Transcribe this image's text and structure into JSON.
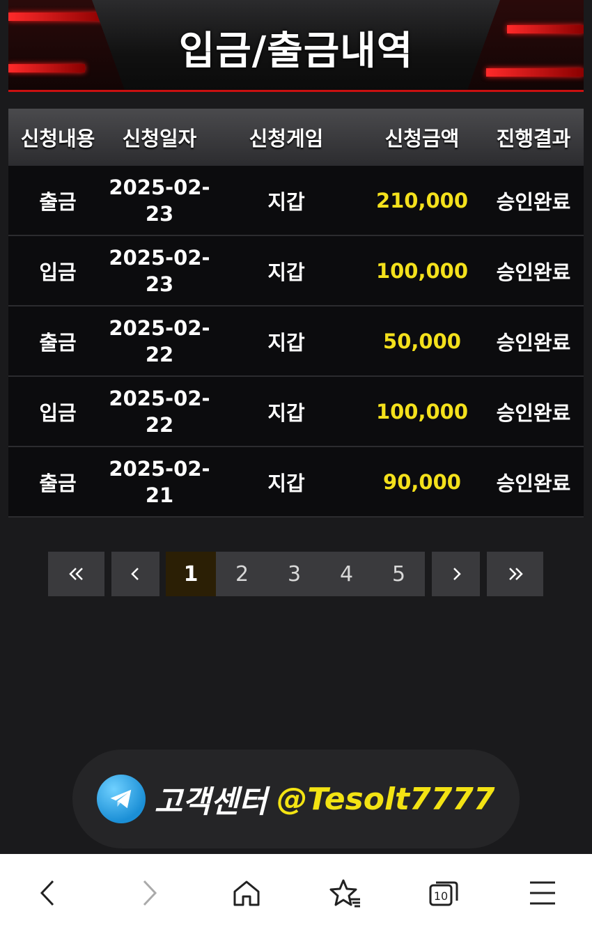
{
  "header": {
    "title": "입금/출금내역"
  },
  "table": {
    "columns": [
      "신청내용",
      "신청일자",
      "신청게임",
      "신청금액",
      "진행결과"
    ],
    "rows": [
      {
        "type": "출금",
        "date_l1": "2025-02-",
        "date_l2": "23",
        "game": "지갑",
        "amount": "210,000",
        "status": "승인완료"
      },
      {
        "type": "입금",
        "date_l1": "2025-02-",
        "date_l2": "23",
        "game": "지갑",
        "amount": "100,000",
        "status": "승인완료"
      },
      {
        "type": "출금",
        "date_l1": "2025-02-",
        "date_l2": "22",
        "game": "지갑",
        "amount": "50,000",
        "status": "승인완료"
      },
      {
        "type": "입금",
        "date_l1": "2025-02-",
        "date_l2": "22",
        "game": "지갑",
        "amount": "100,000",
        "status": "승인완료"
      },
      {
        "type": "출금",
        "date_l1": "2025-02-",
        "date_l2": "21",
        "game": "지갑",
        "amount": "90,000",
        "status": "승인완료"
      }
    ]
  },
  "pagination": {
    "pages": [
      "1",
      "2",
      "3",
      "4",
      "5"
    ],
    "current": "1"
  },
  "support": {
    "label": "고객센터",
    "handle": "@Tesolt7777",
    "icon": "telegram-icon"
  },
  "browser_bar": {
    "icons": [
      "back-icon",
      "forward-icon",
      "home-icon",
      "bookmarks-icon",
      "tabs-icon",
      "menu-icon"
    ],
    "tab_count": "10"
  },
  "colors": {
    "accent_red": "#c91010",
    "amount_yellow": "#f4e11c",
    "handle_yellow": "#f3e313",
    "background": "#1a1a1c"
  }
}
